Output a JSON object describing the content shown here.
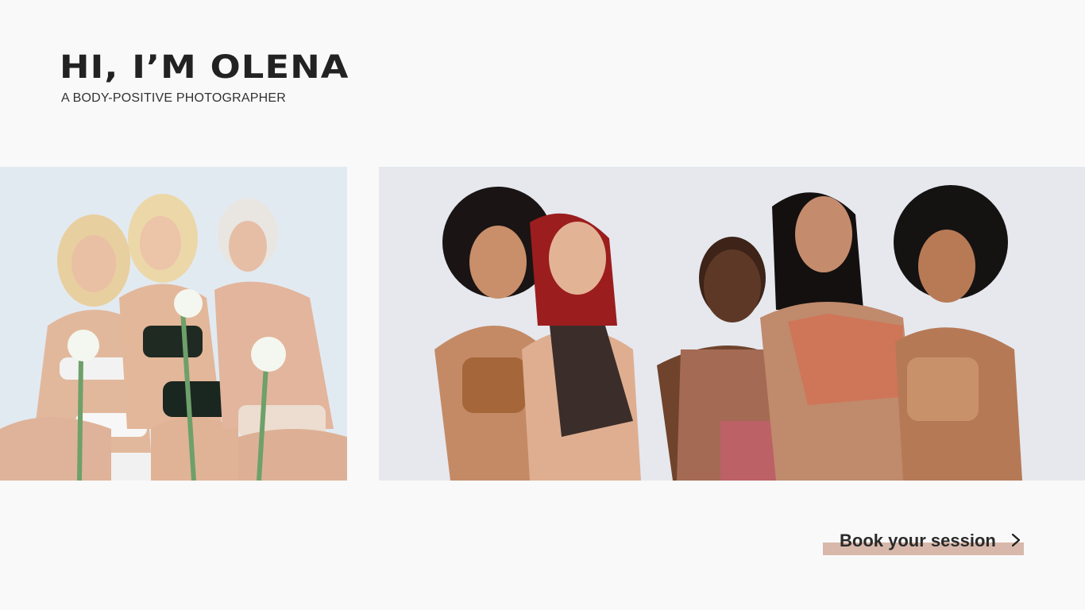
{
  "hero": {
    "title": "HI, I’M OLENA",
    "subtitle": "A BODY-POSITIVE PHOTOGRAPHER"
  },
  "gallery": {
    "left_image": {
      "icon": "photo-three-women-with-flowers"
    },
    "right_image": {
      "icon": "photo-five-women-laughing"
    }
  },
  "cta": {
    "label": "Book your session",
    "icon": "chevron-right-icon",
    "highlight_color": "#d8b8aa"
  },
  "colors": {
    "background": "#f9f9f9",
    "text": "#222222",
    "accent": "#d8b8aa"
  }
}
